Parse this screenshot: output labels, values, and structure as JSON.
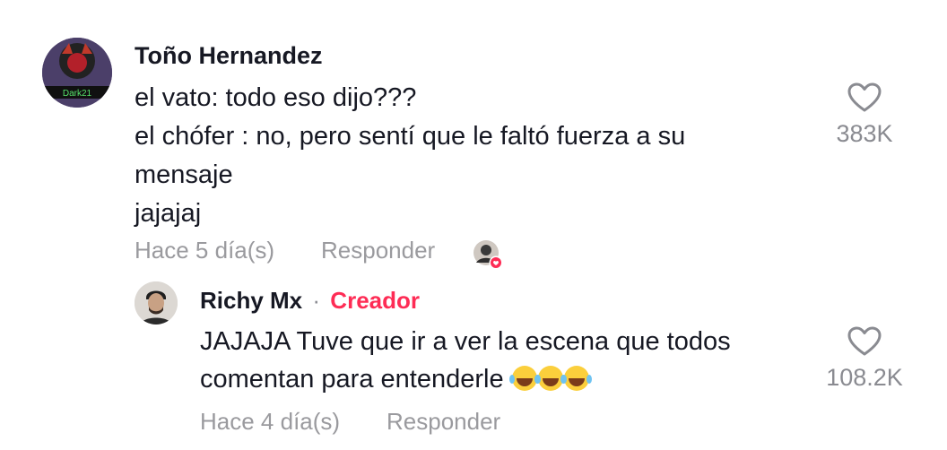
{
  "comment": {
    "author": "Toño Hernandez",
    "avatar_tag": "Dark21",
    "lines": [
      "el vato: todo eso dijo???",
      "el chófer : no, pero sentí que le faltó fuerza a su",
      "mensaje",
      "jajajaj"
    ],
    "time": "Hace 5 día(s)",
    "reply_label": "Responder",
    "likes": "383K",
    "icons": {
      "like": "heart-outline-icon",
      "creator_liked": "creator-liked-avatar-icon"
    }
  },
  "reply": {
    "author": "Richy Mx",
    "separator": "·",
    "badge": "Creador",
    "lines": [
      "JAJAJA Tuve que ir a ver la escena que todos",
      "comentan para entenderle"
    ],
    "time": "Hace 4 día(s)",
    "reply_label": "Responder",
    "likes": "108.2K",
    "icons": {
      "like": "heart-outline-icon",
      "emoji": "tears-of-joy-emoji"
    }
  },
  "colors": {
    "text": "#161823",
    "muted": "#9a9a9e",
    "accent": "#fe2c55"
  }
}
